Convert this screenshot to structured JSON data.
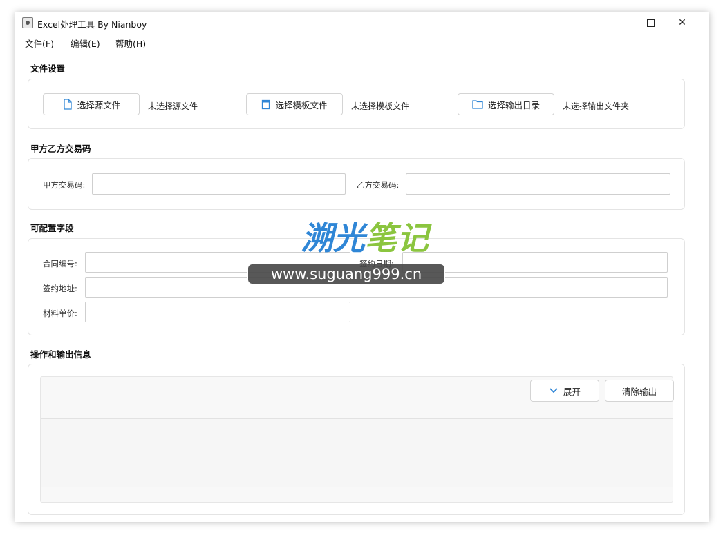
{
  "window": {
    "title": "Excel处理工具 By Nianboy",
    "minimize_glyph": "",
    "close_glyph": "✕"
  },
  "menu": {
    "file": "文件(F)",
    "edit": "编辑(E)",
    "help": "帮助(H)"
  },
  "file_settings": {
    "title": "文件设置",
    "select_source_label": "选择源文件",
    "source_status": "未选择源文件",
    "select_template_label": "选择模板文件",
    "template_status": "未选择模板文件",
    "select_output_label": "选择输出目录",
    "output_status": "未选择输出文件夹"
  },
  "trade_codes": {
    "title": "甲方乙方交易码",
    "party_a_label": "甲方交易码:",
    "party_a_value": "",
    "party_b_label": "乙方交易码:",
    "party_b_value": ""
  },
  "config_fields": {
    "title": "可配置字段",
    "contract_no_label": "合同编号:",
    "contract_no_value": "",
    "sign_date_label": "签约日期:",
    "sign_date_value": "",
    "sign_place_label": "签约地址:",
    "sign_place_value": "",
    "material_price_label": "材料单价:",
    "material_price_value": ""
  },
  "output_info": {
    "title": "操作和输出信息",
    "expand_label": "展开",
    "clear_label": "清除输出"
  },
  "watermark": {
    "logo_part1": "溯光",
    "logo_part2": "笔记",
    "url": "www.suguang999.cn"
  },
  "colors": {
    "accent_icon": "#2f86d6",
    "watermark_blue": "#2f86d6",
    "watermark_green": "#8bc53f"
  },
  "icons": {
    "source_button": "file-icon",
    "template_button": "document-icon",
    "output_button": "folder-icon",
    "expand_button": "chevron-down-icon"
  }
}
